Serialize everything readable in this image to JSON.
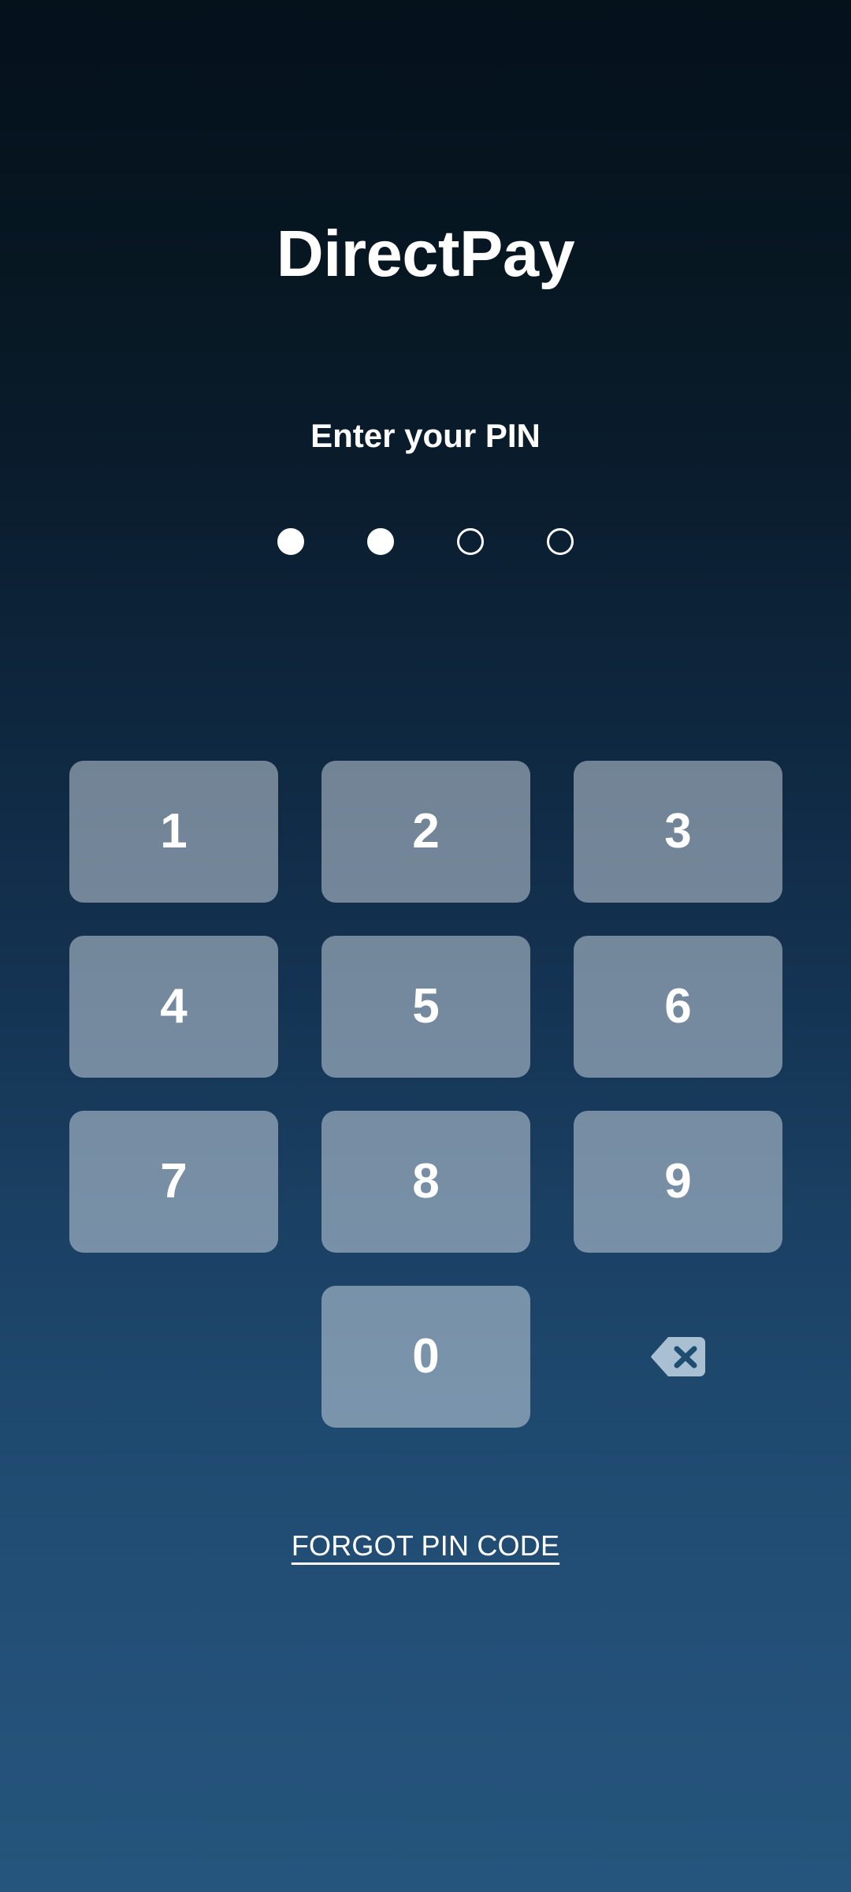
{
  "app": {
    "title": "DirectPay",
    "background_top_color": "#05121c",
    "background_bottom_color": "#25557c"
  },
  "pin": {
    "prompt": "Enter your PIN",
    "length": 4,
    "entered_count": 2,
    "dots": [
      {
        "state": "filled"
      },
      {
        "state": "filled"
      },
      {
        "state": "empty"
      },
      {
        "state": "empty"
      }
    ],
    "dot_filled_color": "#ffffff",
    "dot_outline_color": "#ffffff"
  },
  "keypad": {
    "key_background_color": "rgba(226, 234, 242, 0.47)",
    "key_text_color": "#ffffff",
    "keys": [
      {
        "label": "1",
        "name": "keypad-key-1"
      },
      {
        "label": "2",
        "name": "keypad-key-2"
      },
      {
        "label": "3",
        "name": "keypad-key-3"
      },
      {
        "label": "4",
        "name": "keypad-key-4"
      },
      {
        "label": "5",
        "name": "keypad-key-5"
      },
      {
        "label": "6",
        "name": "keypad-key-6"
      },
      {
        "label": "7",
        "name": "keypad-key-7"
      },
      {
        "label": "8",
        "name": "keypad-key-8"
      },
      {
        "label": "9",
        "name": "keypad-key-9"
      },
      {
        "label": "0",
        "name": "keypad-key-0"
      }
    ],
    "backspace": {
      "icon": "backspace-icon",
      "glyph_color": "#1d4e72",
      "shape_color": "#a9c0d3"
    }
  },
  "footer": {
    "forgot_pin_label": "FORGOT PIN CODE"
  }
}
